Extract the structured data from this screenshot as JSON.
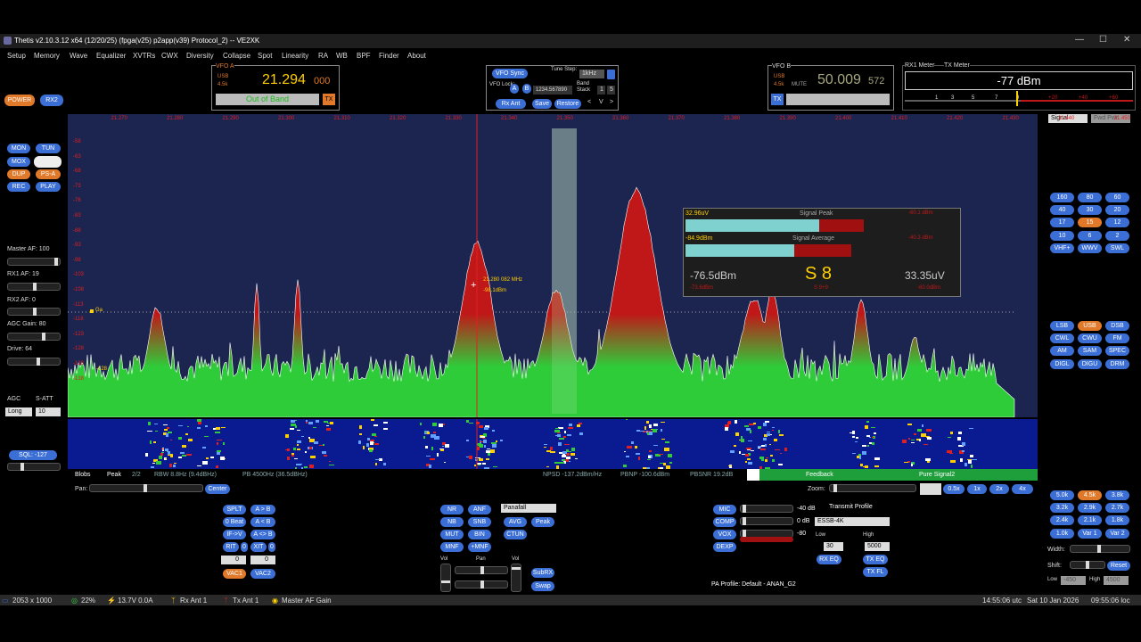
{
  "title": "Thetis v2.10.3.12 x64 (12/20/25) (fpga(v25) p2app(v39) Protocol_2)  --  VE2XK",
  "menu": [
    "Setup",
    "Memory",
    "Wave",
    "Equalizer",
    "XVTRs",
    "CWX",
    "Diversity",
    "Collapse",
    "Spot",
    "Linearity",
    "RA",
    "WB",
    "BPF",
    "Finder",
    "About"
  ],
  "left_buttons": {
    "power": "POWER",
    "rx2": "RX2",
    "mon": "MON",
    "tun": "TUN",
    "mox": "MOX",
    "dup": "DUP",
    "psa": "PS-A",
    "rec": "REC",
    "play": "PLAY"
  },
  "left_controls": {
    "master_af": "Master AF:  100",
    "rx1_af": "RX1 AF:  19",
    "rx2_af": "RX2 AF:  0",
    "agc_gain": "AGC Gain:  80",
    "drive": "Drive:  64",
    "agc": "AGC",
    "satt": "S-ATT",
    "agc_value": "Long",
    "satt_value": "10",
    "sql": "SQL: -127"
  },
  "vfo_a": {
    "label": "VFO A",
    "mode": "USB",
    "bw": "4.5k",
    "freq_main": "21.294",
    "freq_sub": "000",
    "status": "Out of Band",
    "tx": "TX"
  },
  "vfo_sync": {
    "sync": "VFO Sync",
    "tune_step": "Tune Step:",
    "step": "1kHz",
    "vfo_lock": "VFO Lock:",
    "a": "A",
    "b": "B",
    "digits": "1234.567890",
    "band_stack": "Band Stack",
    "bs1": "1",
    "bs2": "5",
    "rx_ant": "Rx Ant",
    "save": "Save",
    "restore": "Restore",
    "lt": "<",
    "v": "V",
    "gt": ">"
  },
  "vfo_b": {
    "label": "VFO B",
    "mode": "USB",
    "bw": "4.5k",
    "mute": "MUTE",
    "freq_main": "50.009",
    "freq_sub": "572",
    "tx": "TX"
  },
  "meter": {
    "rx1": "RX1 Meter",
    "tx": "TX Meter",
    "value": "-77 dBm",
    "scale": [
      "1",
      "3",
      "5",
      "7",
      "9",
      "+20",
      "+40",
      "+60"
    ],
    "signal": "Signal",
    "fwd": "Fwd Pwr"
  },
  "spectrum": {
    "top_freqs": [
      "21.260",
      "21.270",
      "21.280",
      "21.290",
      "21.300",
      "21.310",
      "21.320",
      "21.330",
      "21.340",
      "21.350",
      "21.360",
      "21.370",
      "21.380",
      "21.390",
      "21.400",
      "21.410",
      "21.420",
      "21.430",
      "21.440",
      "21.450"
    ],
    "db_labels": [
      "-58",
      "-63",
      "-68",
      "-73",
      "-78",
      "-83",
      "-88",
      "-93",
      "-98",
      "-103",
      "-108",
      "-113",
      "-118",
      "-123",
      "-128",
      "-133",
      "-138"
    ],
    "cursor_freq": "21.280 082 MHz",
    "cursor_db": "-98.1dBm",
    "ga": "Ga",
    "noise_mark": "-128"
  },
  "signal_box": {
    "peak_value": "32.96uV",
    "peak_label": "Signal Peak",
    "avg_value": "-84.9dBm",
    "avg_label": "Signal Average",
    "dbm": "-76.5dBm",
    "s": "S 8",
    "uv": "33.35uV",
    "peak_red1": "-60.1 dBm",
    "peak_red2": "-40.3 dBm",
    "small_left": "-73.6dBm",
    "small_mid": "S 9+9",
    "small_right": "-60.0dBm",
    "scale": [
      "1",
      "3",
      "5",
      "7",
      "9",
      "+20",
      "+40",
      "+60"
    ]
  },
  "info_row": {
    "blobs": "Blobs",
    "peak": "Peak",
    "count": "2/2",
    "rbw": "RBW 8.8Hz (9.4dBHz)",
    "pb": "PB 4500Hz (36.5dBHz)",
    "npsd": "NPSD -137.2dBm/Hz",
    "pbnp": "PBNP -100.6dBm",
    "pbsnr": "PBSNR 19.2dB",
    "feedback": "Feedback",
    "pure": "Pure Signal2"
  },
  "pan": {
    "pan": "Pan:",
    "center": "Center",
    "zoom": "Zoom:",
    "z05": "0.5x",
    "z1": "1x",
    "z2": "2x",
    "z4": "4x"
  },
  "bands": [
    "160",
    "80",
    "60",
    "40",
    "30",
    "20",
    "17",
    "15",
    "12",
    "10",
    "6",
    "2",
    "VHF+",
    "WWV",
    "SWL"
  ],
  "modes": [
    "LSB",
    "USB",
    "DSB",
    "CWL",
    "CWU",
    "FM",
    "AM",
    "SAM",
    "SPEC",
    "DIGL",
    "DIGU",
    "DRM"
  ],
  "filters": [
    "5.0k",
    "4.5k",
    "3.8k",
    "3.2k",
    "2.9k",
    "2.7k",
    "2.4k",
    "2.1k",
    "1.8k",
    "1.0k",
    "Var 1",
    "Var 2"
  ],
  "filter_ctrl": {
    "width": "Width:",
    "shift": "Shift:",
    "reset": "Reset",
    "low": "Low",
    "high": "High",
    "low_val": "-450",
    "high_val": "4500"
  },
  "split": {
    "splt": "SPLT",
    "ab": "A > B",
    "beat": "0 Beat",
    "ba": "A < B",
    "ifv": "IF->V",
    "swap": "A <> B",
    "rit": "RIT",
    "rit0": "0",
    "xit": "XIT",
    "xit0": "0",
    "rit_val": "0",
    "xit_val": "0",
    "vac1": "VAC1",
    "vac2": "VAC2"
  },
  "dsp": {
    "nr": "NR",
    "anf": "ANF",
    "nb": "NB",
    "snb": "SNB",
    "mut": "MUT",
    "bin": "BIN",
    "mnf": "MNF",
    "pmnf": "+MNF",
    "display": "Panafall",
    "avg": "AVG",
    "peak": "Peak",
    "ctun": "CTUN",
    "vol1": "Vol",
    "pan": "Pan",
    "vol2": "Vol",
    "subrx": "SubRX",
    "swap": "Swap"
  },
  "tx": {
    "mic": "MIC",
    "comp": "COMP",
    "vox": "VOX",
    "dexp": "DEXP",
    "m40": "-40 dB",
    "zero": "0 dB",
    "m80": "-80",
    "profile_lbl": "Transmit Profile",
    "profile": "ESSB-4K",
    "low": "Low",
    "high": "High",
    "low_val": "30",
    "high_val": "5000",
    "rxeq": "RX EQ",
    "txeq": "TX EQ",
    "txfl": "TX FL",
    "pa": "PA Profile: Default - ANAN_G2"
  },
  "status": {
    "res": "2053 x 1000",
    "cpu": "22%",
    "volt": "13.7V  0.0A",
    "rxant": "Rx Ant 1",
    "txant": "Tx Ant 1",
    "master": "Master AF Gain",
    "utc": "14:55:06 utc",
    "date": "Sat 10 Jan 2026",
    "loc": "09:55:06 loc"
  },
  "colors": {
    "accent": "#3b6fd6",
    "orange": "#e07a2a",
    "spectrum_bg": "#1c2450",
    "signal_green": "#2fcc3a",
    "signal_red": "#c01818",
    "vfo_digits": "#ffd000"
  }
}
